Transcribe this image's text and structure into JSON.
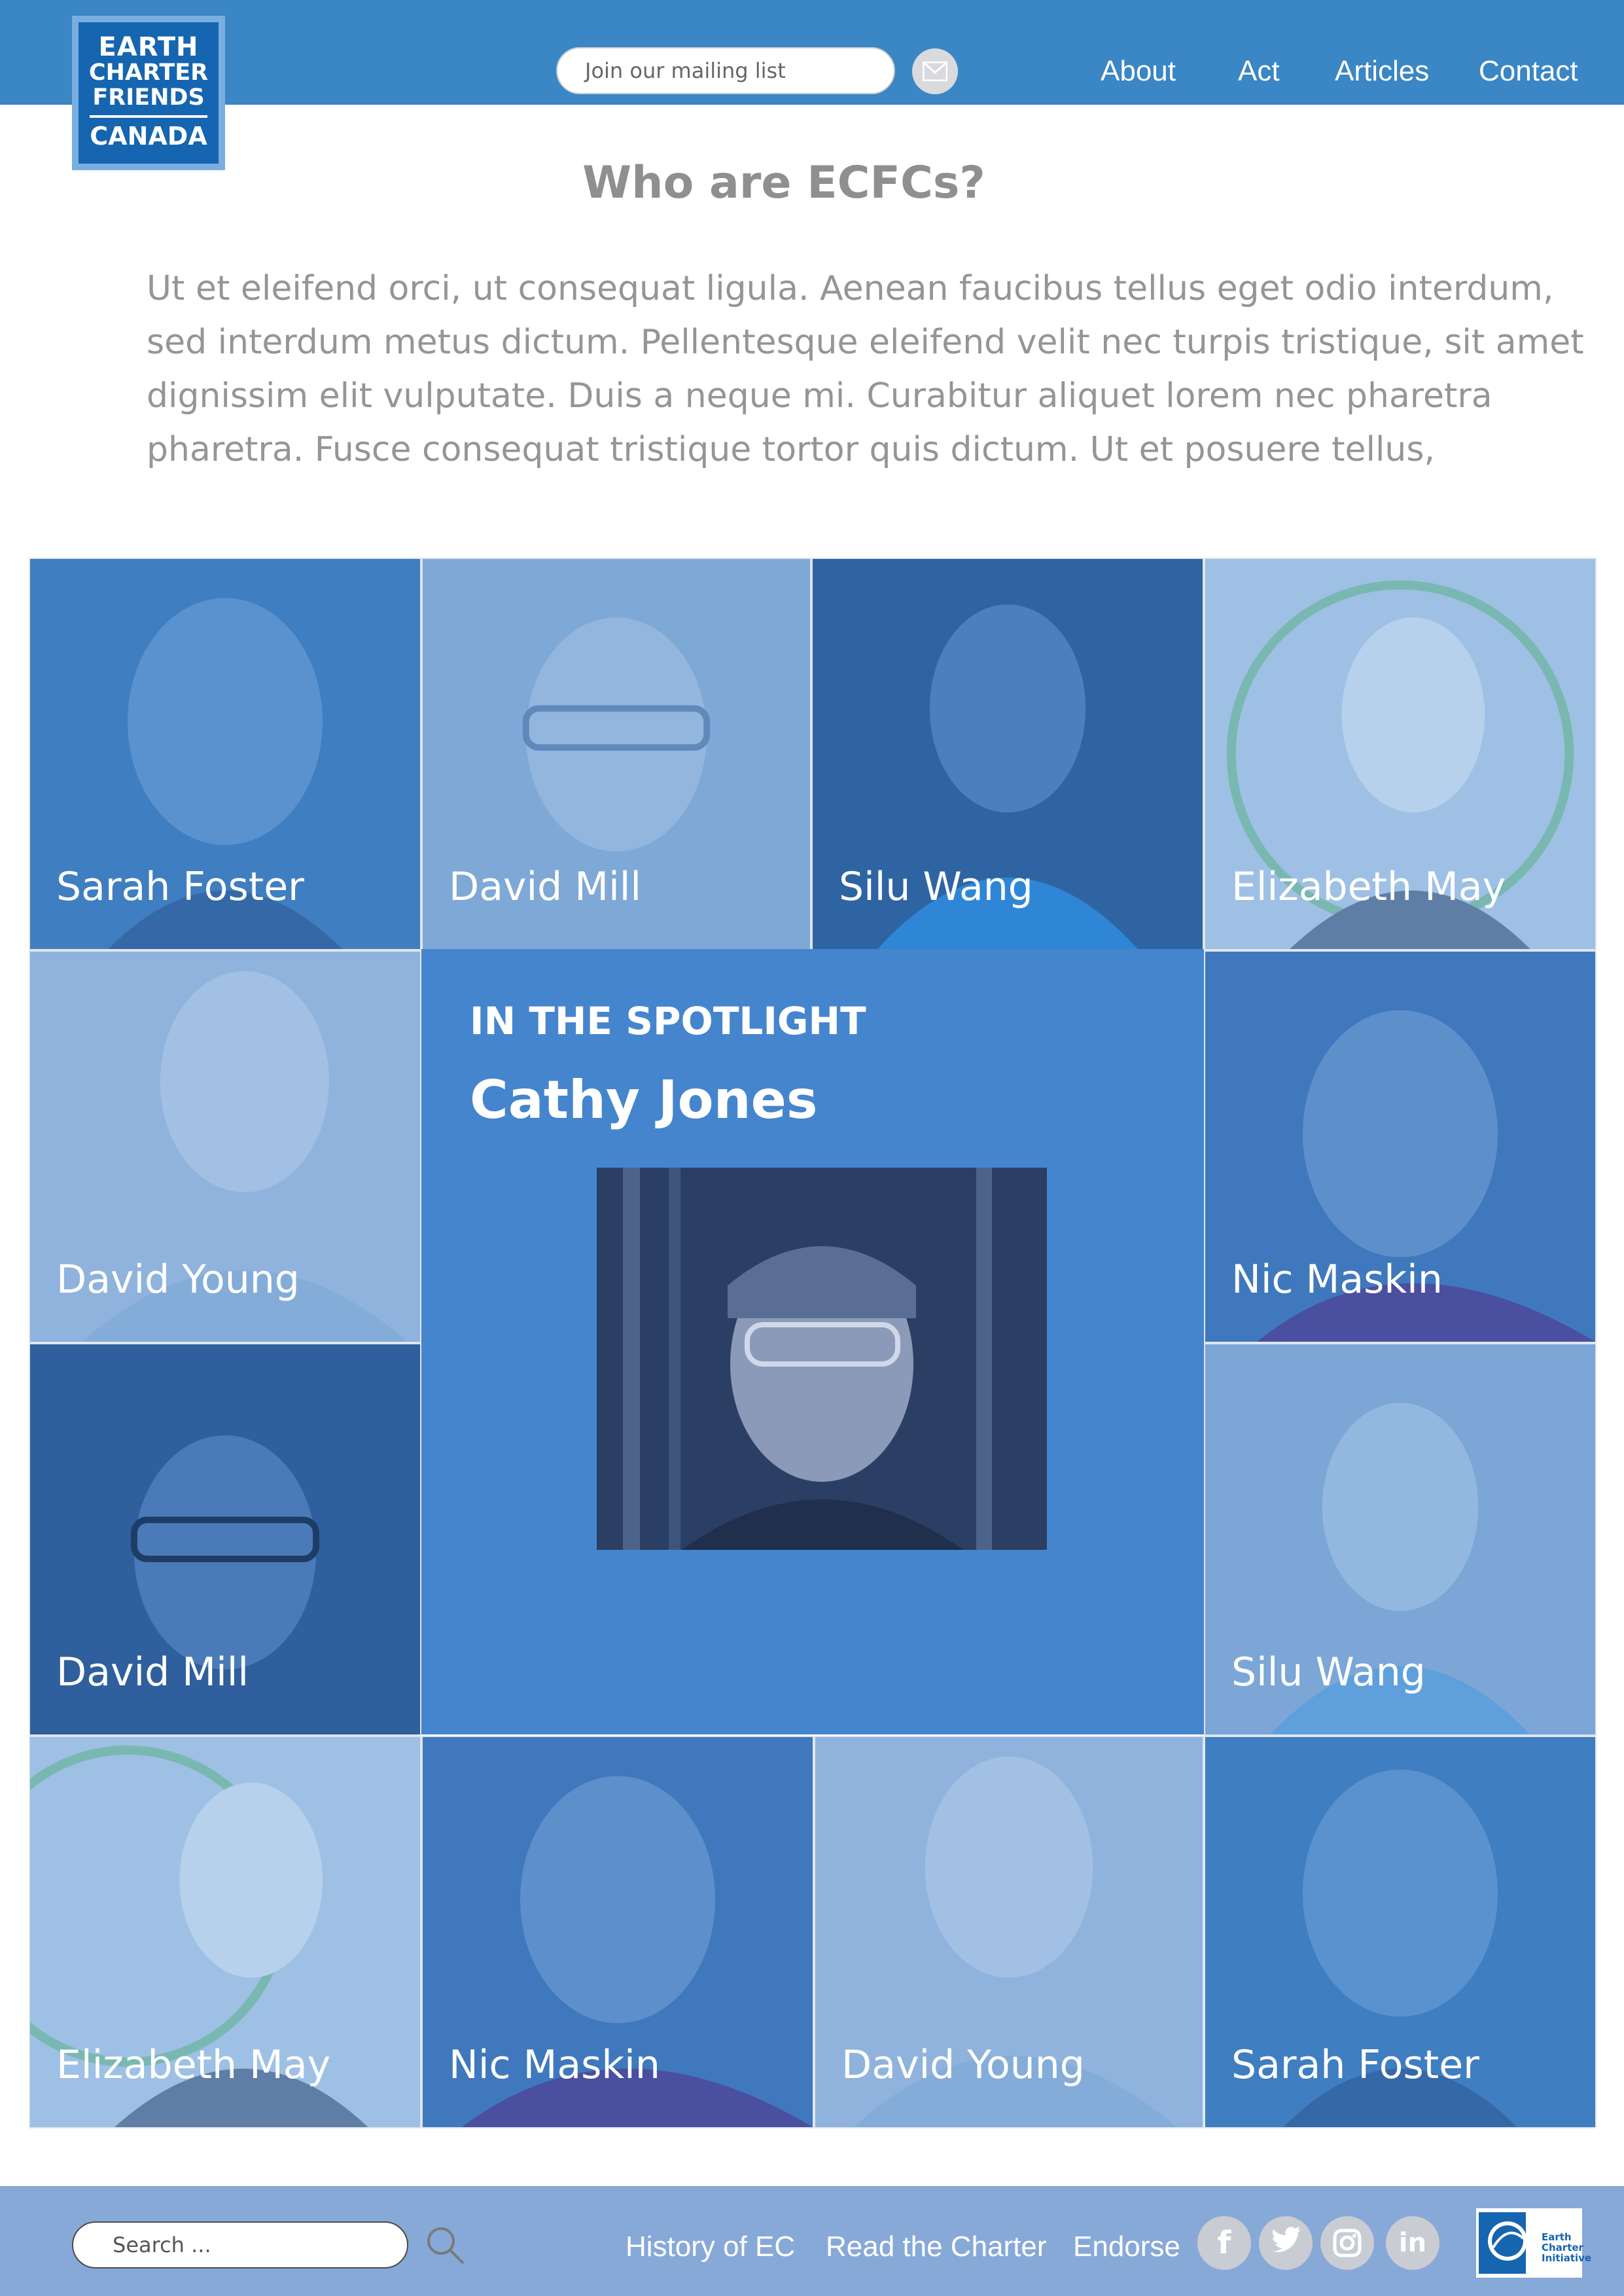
{
  "header": {
    "logo": {
      "line1": "EARTH",
      "line2": "CHARTER",
      "line3": "FRIENDS",
      "line4": "CANADA"
    },
    "mailing_placeholder": "Join our mailing list",
    "mail_icon": "envelope-icon",
    "nav": [
      "About",
      "Act",
      "Articles",
      "Contact"
    ]
  },
  "main": {
    "title": "Who are ECFCs?",
    "intro": "Ut et eleifend orci, ut consequat ligula. Aenean faucibus tellus eget odio interdum, sed interdum metus dictum. Pellentesque eleifend velit nec turpis tristique, sit amet dignissim elit vulputate. Duis a neque mi. Curabitur aliquet lorem nec pharetra pharetra. Fusce consequat tristique tortor quis dictum. Ut et posuere tellus,"
  },
  "members": [
    "Sarah Foster",
    "David Mill",
    "Silu Wang",
    "Elizabeth May",
    "David Young",
    "Nic Maskin",
    "David Mill",
    "Silu Wang",
    "Elizabeth May",
    "Nic Maskin",
    "David Young",
    "Sarah Foster"
  ],
  "spotlight": {
    "eyebrow": "IN THE SPOTLIGHT",
    "name": "Cathy Jones"
  },
  "footer": {
    "search_placeholder": "Search ...",
    "links": [
      "History of EC",
      "Read the Charter",
      "Endorse"
    ],
    "social_icons": [
      "facebook-icon",
      "twitter-icon",
      "instagram-icon",
      "linkedin-icon"
    ],
    "partner_logo": {
      "line1": "Earth",
      "line2": "Charter",
      "line3": "Initiative"
    }
  },
  "colors": {
    "header": "#3b86c4",
    "footer": "#87a9d8",
    "spotlight": "#4585cd",
    "text_gray": "#959595"
  }
}
